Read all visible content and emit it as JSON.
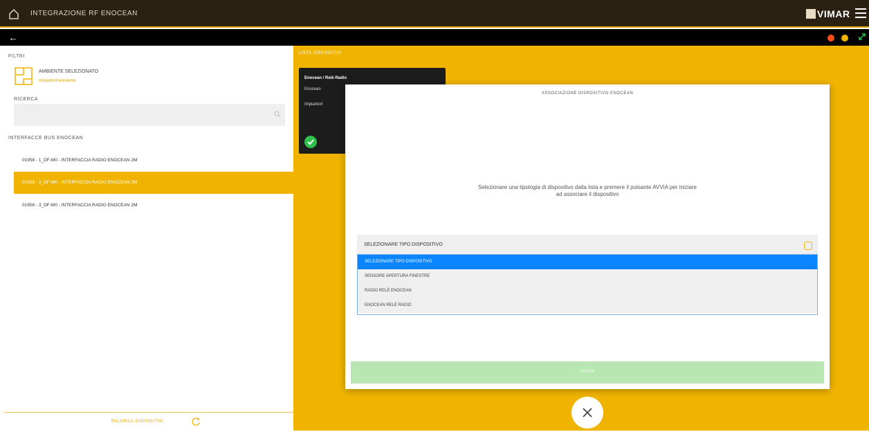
{
  "header": {
    "title": "INTEGRAZIONE RF ENOCEAN",
    "brand": "VIMAR"
  },
  "status_dots": [
    {
      "color": "#ff4d1a"
    },
    {
      "color": "#f0b400"
    },
    {
      "color": "#2fbf4a"
    }
  ],
  "left": {
    "filters_label": "FILTRI",
    "environment": {
      "title": "AMBIENTE SELEZIONATO",
      "subtitle": "Impianto/Inesistente"
    },
    "search_label": "RICERCA",
    "search_placeholder": "",
    "interfaces_label": "INTERFACCE BUS ENOCEAN",
    "interfaces": [
      {
        "label": "01958 - 1_DF-M0 - INTERFACCIA RADIO ENOCEAN 2M"
      },
      {
        "label": "01958 - 2_DF-M0 - INTERFACCIA RADIO ENOCEAN 2M"
      },
      {
        "label": "01958 - 3_DF-M0 - INTERFACCIA RADIO ENOCEAN 2M"
      }
    ],
    "footer": "RICARICA DISPOSITIVI"
  },
  "right": {
    "list_label": "LISTA DISPOSITIVI",
    "device_card": {
      "title": "Enocean / Relè Radio",
      "line1": "Enocean",
      "line2": "Impianto/I"
    }
  },
  "modal": {
    "title": "ASSOCIAZIONE DISPOSITIVO ENOCEAN",
    "message": "Selezionare una tipologia di dispositivo dalla lista e premere il pulsante AVVIA per iniziare ad associare il dispositivo",
    "select_value": "SELEZIONARE TIPO DISPOSITIVO",
    "options": [
      "SELEZIONARE TIPO DISPOSITIVO",
      "SENSORE APERTURA FINESTRE",
      "RADIO RELÈ ENOCEAN",
      "ENOCEAN RELÈ RADIO"
    ],
    "selected_index": 0,
    "start_button": "AVVIA"
  }
}
